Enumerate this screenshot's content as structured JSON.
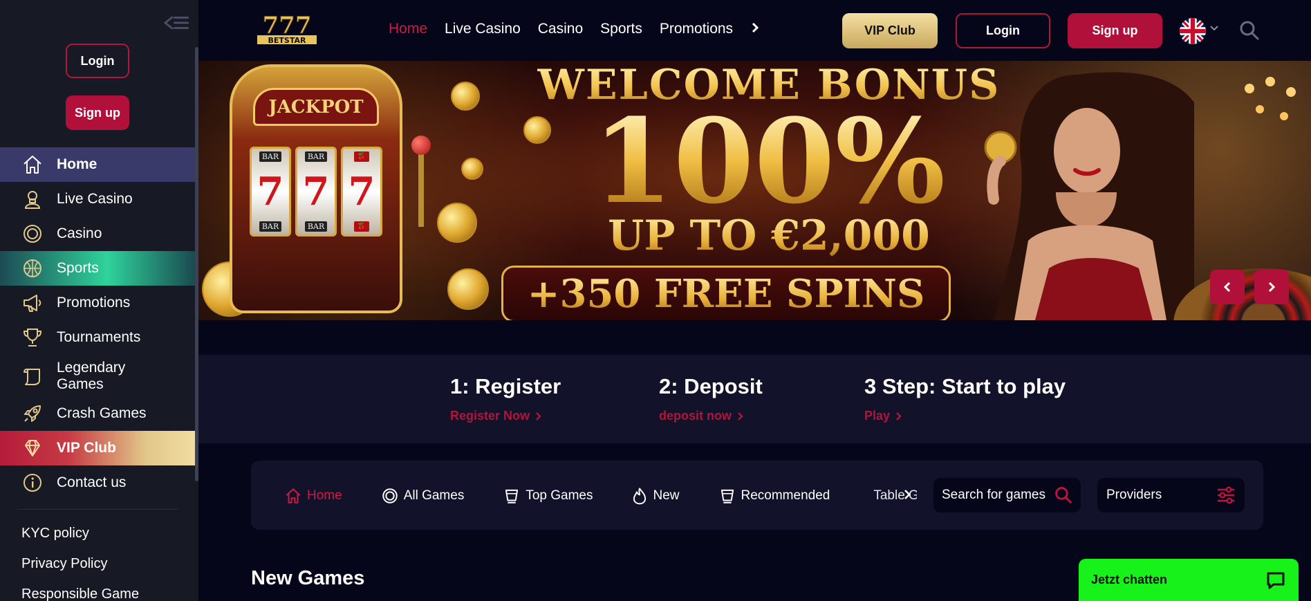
{
  "sidebar": {
    "login_label": "Login",
    "signup_label": "Sign up",
    "items": [
      {
        "label": "Home",
        "icon": "home-icon"
      },
      {
        "label": "Live Casino",
        "icon": "dealer-icon"
      },
      {
        "label": "Casino",
        "icon": "chip-icon"
      },
      {
        "label": "Sports",
        "icon": "ball-icon"
      },
      {
        "label": "Promotions",
        "icon": "megaphone-icon"
      },
      {
        "label": "Tournaments",
        "icon": "trophy-icon"
      },
      {
        "label": "Legendary Games",
        "icon": "scroll-icon"
      },
      {
        "label": "Crash Games",
        "icon": "rocket-icon"
      },
      {
        "label": "VIP Club",
        "icon": "diamond-icon"
      },
      {
        "label": "Contact us",
        "icon": "info-icon"
      }
    ],
    "links": [
      "KYC policy",
      "Privacy Policy",
      "Responsible Game"
    ]
  },
  "header": {
    "logo_text": "777",
    "logo_sub": "BETSTAR",
    "nav": [
      "Home",
      "Live Casino",
      "Casino",
      "Sports",
      "Promotions"
    ],
    "active_nav": "Home",
    "vip_label": "VIP Club",
    "login_label": "Login",
    "signup_label": "Sign up",
    "language": "English (UK flag)"
  },
  "banner": {
    "jackpot": "JACKPOT",
    "reel_symbol": "7",
    "reel_bar": "BAR",
    "title": "WELCOME BONUS",
    "percent": "100%",
    "upto": "UP TO €2,000",
    "spins": "+350 FREE SPINS"
  },
  "steps": [
    {
      "title": "1: Register",
      "link": "Register Now"
    },
    {
      "title": "2: Deposit",
      "link": "deposit now"
    },
    {
      "title": "3 Step: Start to play",
      "link": "Play"
    }
  ],
  "games_bar": {
    "tabs": [
      {
        "label": "Home",
        "icon": "home-icon"
      },
      {
        "label": "All Games",
        "icon": "chip-icon"
      },
      {
        "label": "Top Games",
        "icon": "cup-icon"
      },
      {
        "label": "New",
        "icon": "flame-icon"
      },
      {
        "label": "Recommended",
        "icon": "cup-icon"
      },
      {
        "label": "Table Games",
        "icon": "dice-icon"
      }
    ],
    "search_placeholder": "Search for games",
    "providers_label": "Providers"
  },
  "section_title": "New Games",
  "chat_label": "Jetzt chatten",
  "colors": {
    "accent": "#b0103a",
    "active": "#d01a44",
    "chat": "#17f21a",
    "gold": "#e2c889"
  }
}
